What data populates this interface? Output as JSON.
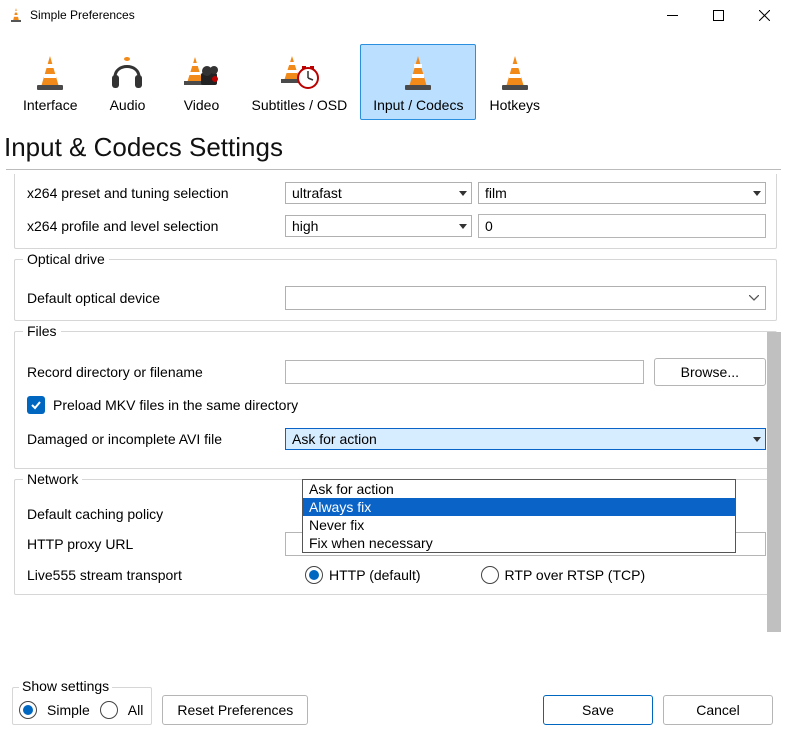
{
  "window": {
    "title": "Simple Preferences"
  },
  "tabs": {
    "interface": "Interface",
    "audio": "Audio",
    "video": "Video",
    "subtitles": "Subtitles / OSD",
    "input_codecs": "Input / Codecs",
    "hotkeys": "Hotkeys"
  },
  "heading": "Input & Codecs Settings",
  "codec": {
    "preset_label": "x264 preset and tuning selection",
    "preset_value": "ultrafast",
    "tuning_value": "film",
    "profile_label": "x264 profile and level selection",
    "profile_value": "high",
    "level_value": "0"
  },
  "optical": {
    "title": "Optical drive",
    "default_label": "Default optical device",
    "default_value": ""
  },
  "files": {
    "title": "Files",
    "record_label": "Record directory or filename",
    "record_value": "",
    "browse": "Browse...",
    "preload_label": "Preload MKV files in the same directory",
    "avi_label": "Damaged or incomplete AVI file",
    "avi_value": "Ask for action",
    "avi_options": [
      "Ask for action",
      "Always fix",
      "Never fix",
      "Fix when necessary"
    ],
    "avi_highlight_index": 1
  },
  "network": {
    "title": "Network",
    "cache_label": "Default caching policy",
    "proxy_label": "HTTP proxy URL",
    "proxy_value": "",
    "live_label": "Live555 stream transport",
    "live_http": "HTTP (default)",
    "live_rtp": "RTP over RTSP (TCP)"
  },
  "footer": {
    "show_settings": "Show settings",
    "simple": "Simple",
    "all": "All",
    "reset": "Reset Preferences",
    "save": "Save",
    "cancel": "Cancel"
  }
}
